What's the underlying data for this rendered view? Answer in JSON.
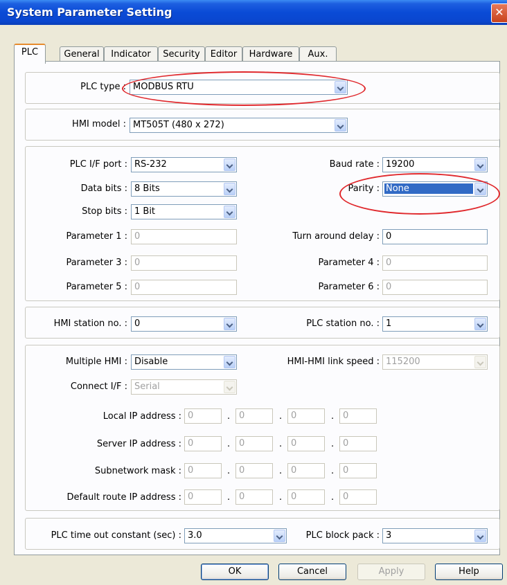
{
  "window": {
    "title": "System Parameter Setting",
    "close_glyph": "✕"
  },
  "tabs": [
    "PLC",
    "General",
    "Indicator",
    "Security",
    "Editor",
    "Hardware",
    "Aux."
  ],
  "plc_type": {
    "label": "PLC type :",
    "value": "MODBUS RTU"
  },
  "hmi_model": {
    "label": "HMI model :",
    "value": "MT505T (480 x 272)"
  },
  "comm": {
    "plc_if_port": {
      "label": "PLC I/F port :",
      "value": "RS-232"
    },
    "data_bits": {
      "label": "Data bits :",
      "value": "8 Bits"
    },
    "stop_bits": {
      "label": "Stop bits :",
      "value": "1 Bit"
    },
    "param1": {
      "label": "Parameter 1 :",
      "value": "0"
    },
    "param3": {
      "label": "Parameter 3 :",
      "value": "0"
    },
    "param5": {
      "label": "Parameter 5 :",
      "value": "0"
    },
    "baud_rate": {
      "label": "Baud rate :",
      "value": "19200"
    },
    "parity": {
      "label": "Parity :",
      "value": "None"
    },
    "turn_around": {
      "label": "Turn around delay :",
      "value": "0"
    },
    "param4": {
      "label": "Parameter 4 :",
      "value": "0"
    },
    "param6": {
      "label": "Parameter 6 :",
      "value": "0"
    }
  },
  "station": {
    "hmi": {
      "label": "HMI station no. :",
      "value": "0"
    },
    "plc": {
      "label": "PLC station no. :",
      "value": "1"
    }
  },
  "network": {
    "multiple_hmi": {
      "label": "Multiple HMI :",
      "value": "Disable"
    },
    "connect_if": {
      "label": "Connect I/F :",
      "value": "Serial"
    },
    "link_speed": {
      "label": "HMI-HMI link speed :",
      "value": "115200"
    },
    "local_ip": {
      "label": "Local IP address :",
      "values": [
        "0",
        "0",
        "0",
        "0"
      ]
    },
    "server_ip": {
      "label": "Server IP address :",
      "values": [
        "0",
        "0",
        "0",
        "0"
      ]
    },
    "subnet": {
      "label": "Subnetwork mask :",
      "values": [
        "0",
        "0",
        "0",
        "0"
      ]
    },
    "route_ip": {
      "label": "Default route IP address :",
      "values": [
        "0",
        "0",
        "0",
        "0"
      ]
    },
    "dot": "."
  },
  "timeout": {
    "time_out": {
      "label": "PLC time out constant (sec) :",
      "value": "3.0"
    },
    "block_pack": {
      "label": "PLC block pack :",
      "value": "3"
    }
  },
  "buttons": {
    "ok": "OK",
    "cancel": "Cancel",
    "apply": "Apply",
    "help": "Help"
  },
  "colors": {
    "highlight_oval": "#e0282c",
    "title_bar": "#0a4bd6",
    "selection": "#316ac5"
  }
}
